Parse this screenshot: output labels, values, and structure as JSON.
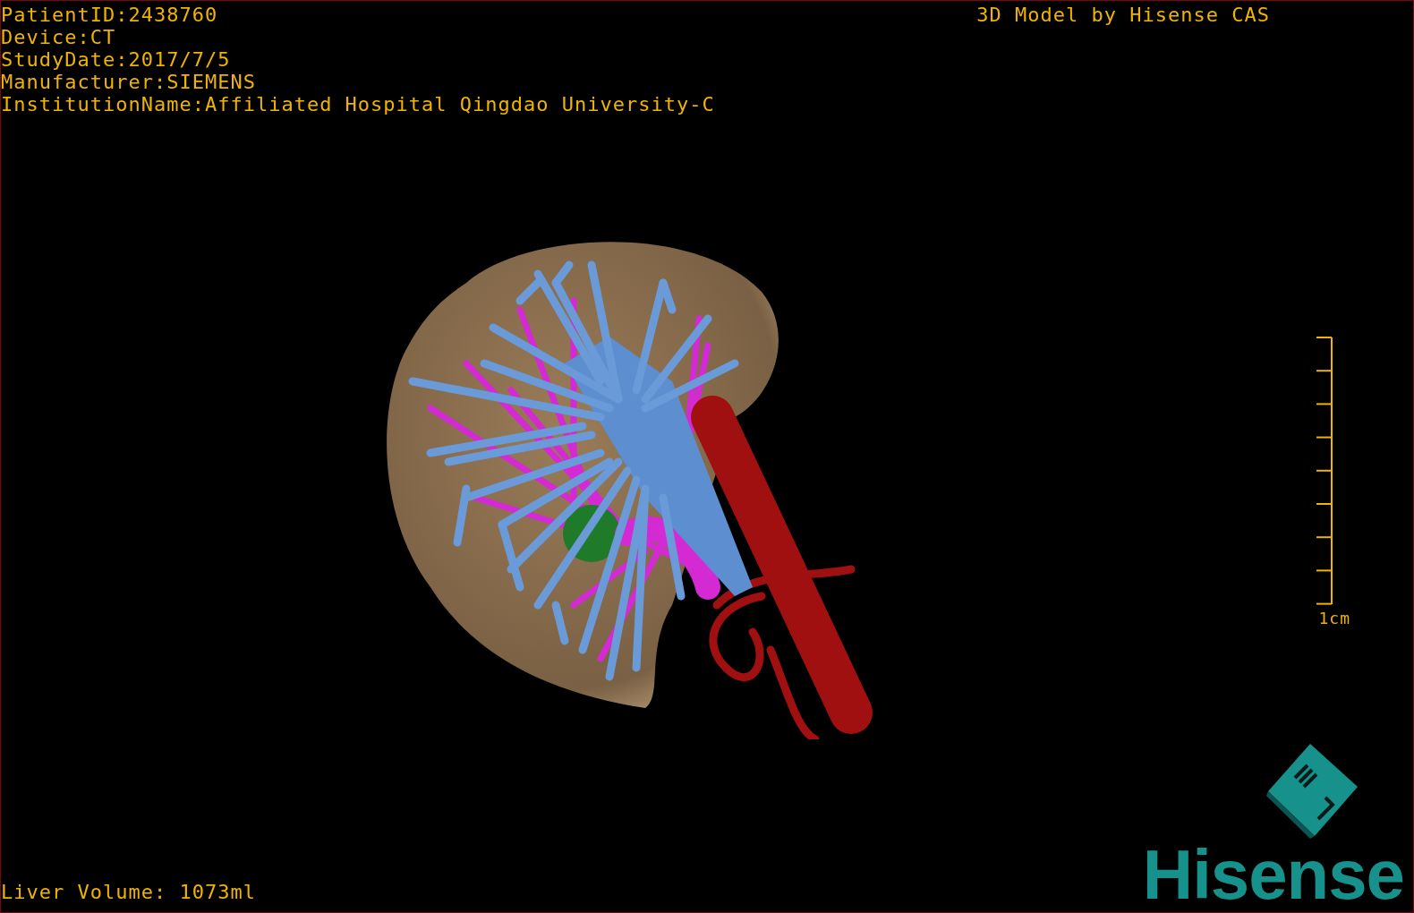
{
  "patient_info": [
    "PatientID:2438760",
    "Device:CT",
    "StudyDate:2017/7/5",
    "Manufacturer:SIEMENS",
    "InstitutionName:Affiliated Hospital Qingdao University-C"
  ],
  "title": "3D Model by Hisense CAS",
  "scale_bar": {
    "label": "1cm"
  },
  "liver_volume": "Liver Volume: 1073ml",
  "logo": {
    "wordmark": "Hisense"
  }
}
